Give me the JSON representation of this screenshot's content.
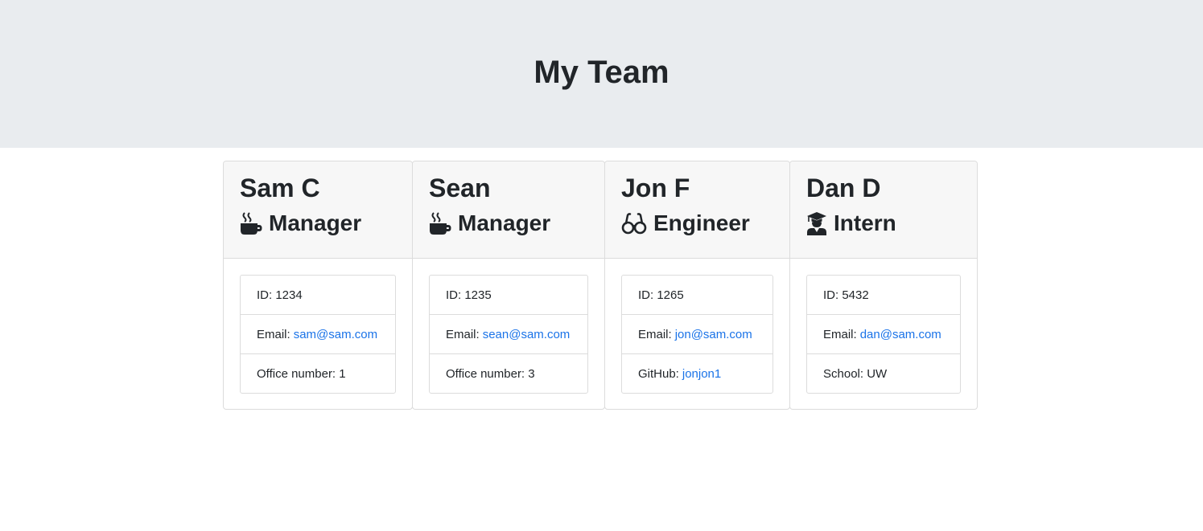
{
  "header": {
    "title": "My Team"
  },
  "members": [
    {
      "name": "Sam C",
      "role": "Manager",
      "icon": "coffee-mug-icon",
      "id_label": "ID:",
      "id": "1234",
      "email_label": "Email:",
      "email": "sam@sam.com",
      "extra_label": "Office number:",
      "extra": "1"
    },
    {
      "name": "Sean",
      "role": "Manager",
      "icon": "coffee-mug-icon",
      "id_label": "ID:",
      "id": "1235",
      "email_label": "Email:",
      "email": "sean@sam.com",
      "extra_label": "Office number:",
      "extra": "3"
    },
    {
      "name": "Jon F",
      "role": "Engineer",
      "icon": "glasses-icon",
      "id_label": "ID:",
      "id": "1265",
      "email_label": "Email:",
      "email": "jon@sam.com",
      "extra_label": "GitHub:",
      "extra": "jonjon1"
    },
    {
      "name": "Dan D",
      "role": "Intern",
      "icon": "graduate-icon",
      "id_label": "ID:",
      "id": "5432",
      "email_label": "Email:",
      "email": "dan@sam.com",
      "extra_label": "School:",
      "extra": "UW"
    }
  ],
  "colors": {
    "link": "#1a73e8",
    "header_bg": "#e9ecef",
    "card_header_bg": "#f7f7f7"
  }
}
